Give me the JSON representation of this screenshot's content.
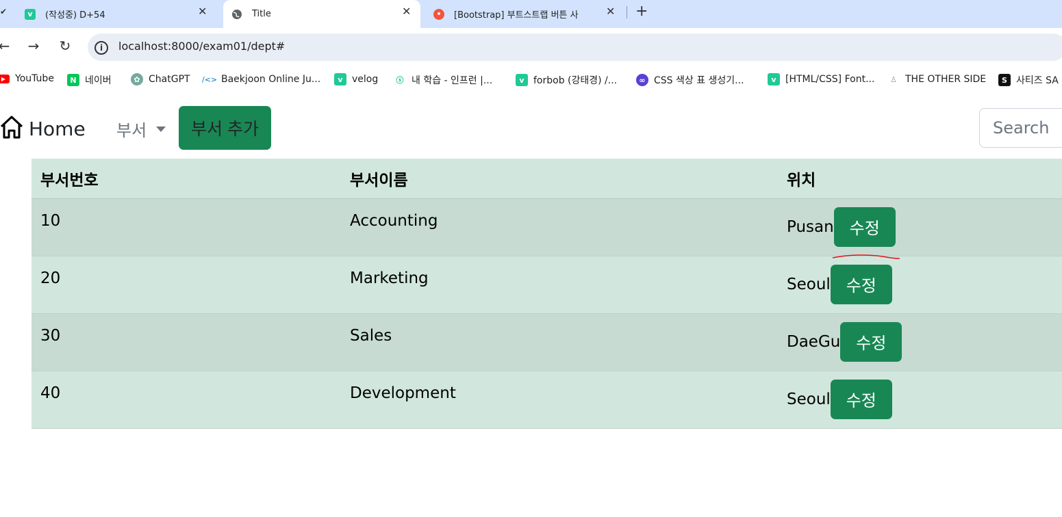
{
  "browser": {
    "tabs": [
      {
        "title": "(작성중) D+54",
        "favicon": "velog-icon",
        "active": false
      },
      {
        "title": "Title",
        "favicon": "globe-icon",
        "active": true
      },
      {
        "title": "[Bootstrap] 부트스트랩 버튼 사",
        "favicon": "tistory-icon",
        "active": false
      }
    ],
    "url": "localhost:8000/exam01/dept#",
    "bookmarks": [
      {
        "label": "YouTube",
        "icon": "youtube-icon",
        "color": "#ff0000"
      },
      {
        "label": "네이버",
        "icon": "naver-icon",
        "color": "#03c75a"
      },
      {
        "label": "ChatGPT",
        "icon": "chatgpt-icon",
        "color": "#74aa9c"
      },
      {
        "label": "Baekjoon Online Ju...",
        "icon": "code-icon",
        "color": "#0076c0"
      },
      {
        "label": "velog",
        "icon": "velog-icon",
        "color": "#20c997"
      },
      {
        "label": "내 학습 - 인프런 |...",
        "icon": "inflearn-icon",
        "color": "#1dc078"
      },
      {
        "label": "forbob (강태경) /...",
        "icon": "velog-icon",
        "color": "#20c997"
      },
      {
        "label": "CSS 색상 표 생성기...",
        "icon": "palette-icon",
        "color": "#5b3fd6"
      },
      {
        "label": "[HTML/CSS] Font...",
        "icon": "velog-icon",
        "color": "#20c997"
      },
      {
        "label": "THE OTHER SIDE",
        "icon": "site-icon",
        "color": "#999999"
      },
      {
        "label": "사티즈 SA",
        "icon": "s-icon",
        "color": "#111111"
      }
    ]
  },
  "page": {
    "brand": "Home",
    "dropdown_label": "부서",
    "add_button": "부서 추가",
    "search_placeholder": "Search"
  },
  "table": {
    "headers": [
      "부서번호",
      "부서이름",
      "위치"
    ],
    "rows": [
      {
        "deptno": "10",
        "dname": "Accounting",
        "loc": "Pusan"
      },
      {
        "deptno": "20",
        "dname": "Marketing",
        "loc": "Seoul"
      },
      {
        "deptno": "30",
        "dname": "Sales",
        "loc": "DaeGu"
      },
      {
        "deptno": "40",
        "dname": "Development",
        "loc": "Seoul"
      }
    ],
    "edit_label": "수정"
  },
  "colors": {
    "primary": "#198754",
    "table_bg": "#d1e7dd",
    "table_striped": "#c7dbd2",
    "tabstrip": "#d3e3fd"
  }
}
